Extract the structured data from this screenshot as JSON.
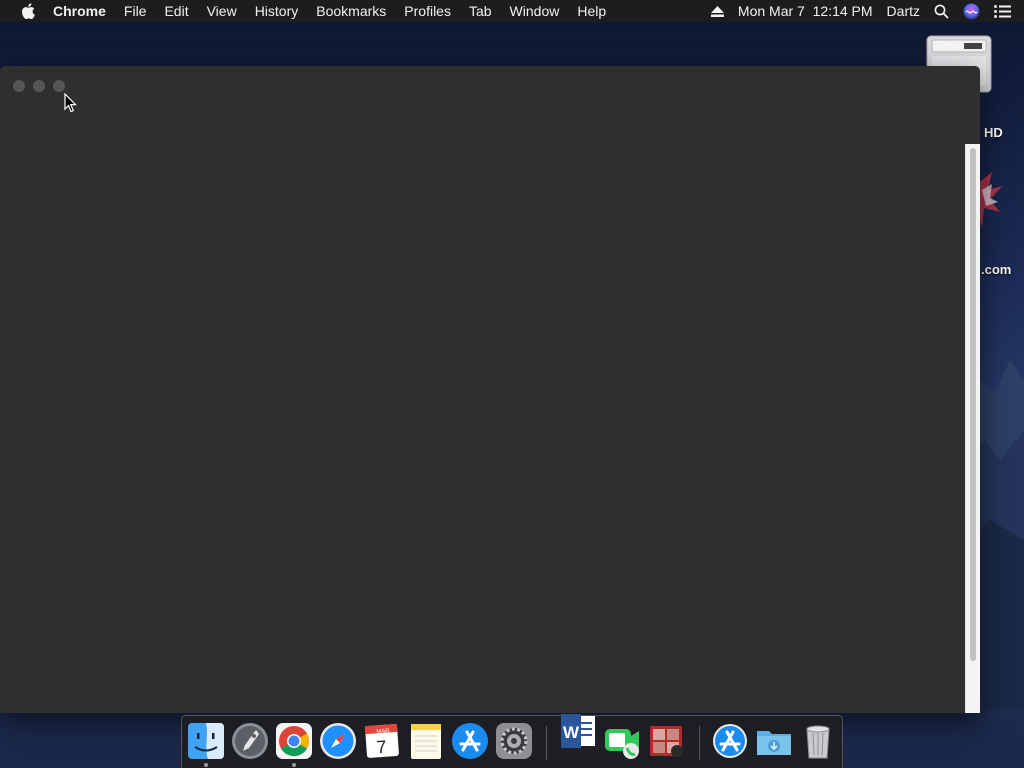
{
  "menubar": {
    "app_name": "Chrome",
    "items": [
      "File",
      "Edit",
      "View",
      "History",
      "Bookmarks",
      "Profiles",
      "Tab",
      "Window",
      "Help"
    ],
    "datetime": "Mon Mar 7  12:14 PM",
    "user": "Dartz"
  },
  "desktop": {
    "icons": [
      {
        "label": "HD",
        "icon": "hard-drive-icon"
      },
      {
        "label": ".com",
        "icon": "web-shortcut-icon"
      }
    ]
  },
  "window": {
    "app": "Chrome",
    "state": "blank dark page"
  },
  "dock": {
    "calendar_month": "MAR",
    "calendar_day": "7",
    "word_letter": "W",
    "items": [
      "finder-icon",
      "launchpad-icon",
      "chrome-icon",
      "safari-icon",
      "calendar-icon",
      "notes-icon",
      "app-store-icon",
      "system-preferences-icon",
      "word-icon",
      "facetime-icon",
      "photo-booth-icon",
      "app-store-2-icon",
      "downloads-folder-icon",
      "trash-icon"
    ]
  },
  "colors": {
    "menubar": "#1d1d1f",
    "window_bg": "#2f2f2f",
    "scrollbar_track": "#f4f4f4"
  }
}
